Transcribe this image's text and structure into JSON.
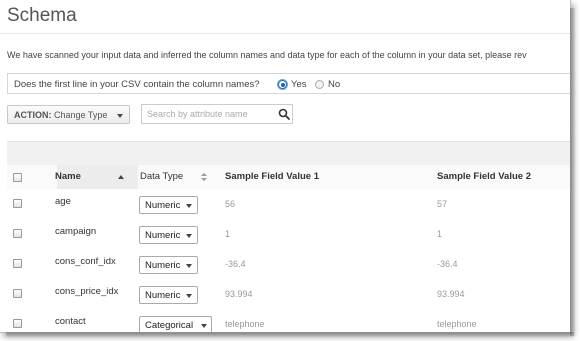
{
  "page": {
    "title": "Schema",
    "description": "We have scanned your input data and inferred the column names and data type for each of the column in your data set, please rev"
  },
  "header_question": {
    "text": "Does the first line in your CSV contain the column names?",
    "options": [
      {
        "label": "Yes",
        "selected": true
      },
      {
        "label": "No",
        "selected": false
      }
    ]
  },
  "toolbar": {
    "action_label": "ACTION:",
    "action_value": "Change Type",
    "search_placeholder": "Search by attribute name"
  },
  "table": {
    "columns": [
      "Name",
      "Data Type",
      "Sample Field Value 1",
      "Sample Field Value 2"
    ],
    "rows": [
      {
        "name": "age",
        "type": "Numeric",
        "v1": "56",
        "v2": "57"
      },
      {
        "name": "campaign",
        "type": "Numeric",
        "v1": "1",
        "v2": "1"
      },
      {
        "name": "cons_conf_idx",
        "type": "Numeric",
        "v1": "-36.4",
        "v2": "-36.4"
      },
      {
        "name": "cons_price_idx",
        "type": "Numeric",
        "v1": "93.994",
        "v2": "93.994"
      },
      {
        "name": "contact",
        "type": "Categorical",
        "v1": "telephone",
        "v2": "telephone"
      }
    ]
  },
  "icons": {
    "search": "search-icon",
    "dropdown": "chevron-down-icon",
    "sort_ascending": "sort-up-icon",
    "sort_both": "sort-icon"
  },
  "colors": {
    "radio_selected": "#1f5fa6",
    "table_header_bg": "#f1f1f1",
    "sample_value_text": "#999999"
  }
}
